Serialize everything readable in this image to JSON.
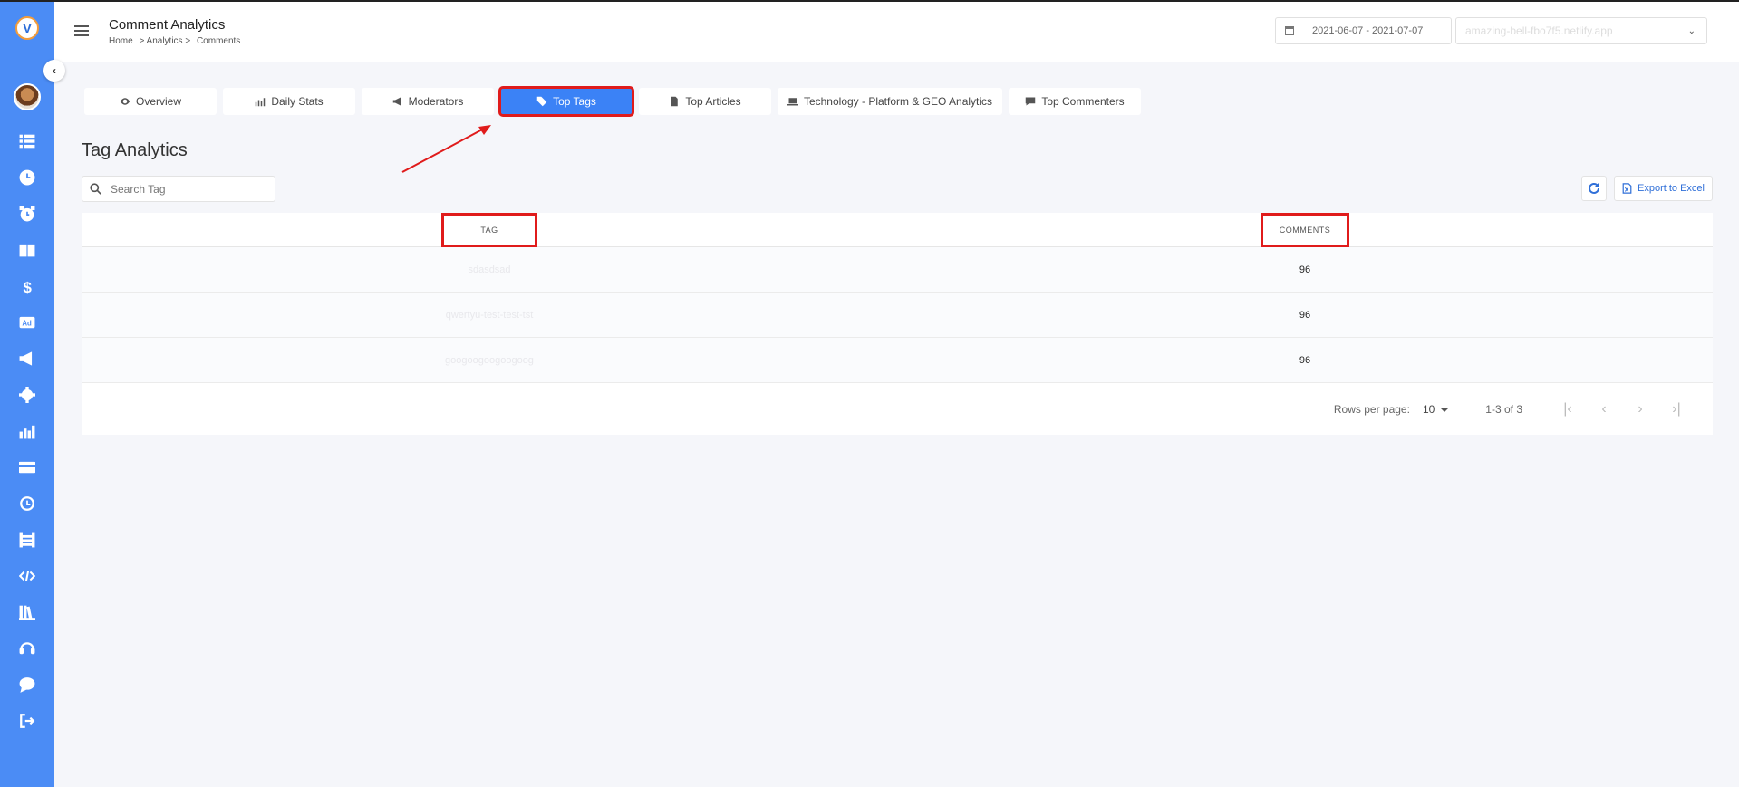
{
  "sidebar": {
    "logo_letter": "V",
    "icons": [
      "list-icon",
      "clock-icon",
      "alarm-icon",
      "book-icon",
      "dollar-icon",
      "ad-icon",
      "megaphone-icon",
      "gear-icon",
      "chart-icon",
      "card-icon",
      "history-icon",
      "abacus-icon",
      "code-icon",
      "library-icon",
      "headset-icon",
      "chat-icon",
      "logout-icon"
    ]
  },
  "header": {
    "title": "Comment Analytics",
    "breadcrumb": [
      "Home",
      "> Analytics >",
      "Comments"
    ],
    "date_range": "2021-06-07 - 2021-07-07",
    "site": "amazing-bell-fbo7f5.netlify.app"
  },
  "tabs": [
    {
      "label": "Overview",
      "icon": "eye-icon"
    },
    {
      "label": "Daily Stats",
      "icon": "chart-icon"
    },
    {
      "label": "Moderators",
      "icon": "megaphone-icon"
    },
    {
      "label": "Top Tags",
      "icon": "tags-icon",
      "active": true
    },
    {
      "label": "Top Articles",
      "icon": "file-icon"
    },
    {
      "label": "Technology - Platform & GEO Analytics",
      "icon": "laptop-icon"
    },
    {
      "label": "Top Commenters",
      "icon": "comment-icon"
    }
  ],
  "section_title": "Tag Analytics",
  "search": {
    "placeholder": "Search Tag"
  },
  "export_label": "Export to Excel",
  "table": {
    "headers": {
      "tag": "TAG",
      "comments": "COMMENTS"
    },
    "rows": [
      {
        "tag": "sdasdsad",
        "comments": "96"
      },
      {
        "tag": "qwertyu-test-test-tst",
        "comments": "96"
      },
      {
        "tag": "googoogoogoogoog",
        "comments": "96"
      }
    ]
  },
  "pagination": {
    "rows_per_page_label": "Rows per page:",
    "rows_per_page": "10",
    "range": "1-3 of 3"
  },
  "colors": {
    "sidebar": "#4b8cf5",
    "active_tab": "#3b82f6",
    "highlight": "#e01b1b"
  }
}
